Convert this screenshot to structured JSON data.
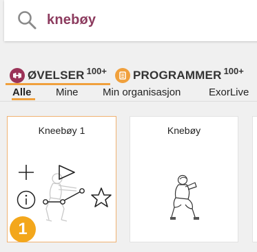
{
  "search": {
    "value": "knebøy"
  },
  "categories": [
    {
      "label": "ØVELSER",
      "count": "100+",
      "active": true,
      "icon": "dumbbell-icon"
    },
    {
      "label": "PROGRAMMER",
      "count": "100+",
      "active": false,
      "icon": "document-icon"
    }
  ],
  "filters": [
    {
      "label": "Alle",
      "active": true
    },
    {
      "label": "Mine",
      "active": false
    },
    {
      "label": "Min organisasjon",
      "active": false
    },
    {
      "label": "ExorLive",
      "active": false
    }
  ],
  "cards": [
    {
      "title": "Kneebøy 1",
      "badge": "1",
      "selected": true
    },
    {
      "title": "Knebøy",
      "selected": false
    }
  ],
  "colors": {
    "accent": "#f0a03c",
    "brand": "#9b3358",
    "search_text": "#8c3b5e",
    "badge": "#f3a71c"
  }
}
